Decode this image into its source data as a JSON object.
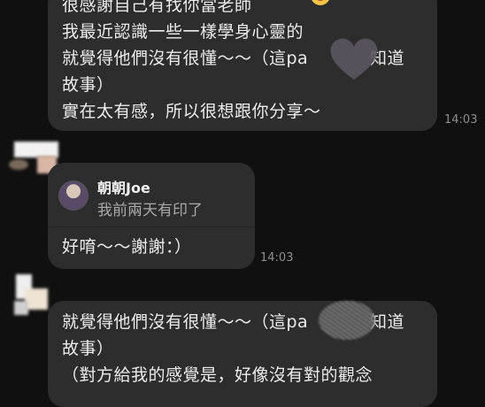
{
  "message_1": {
    "lines": [
      "很感謝自己有找你當老師",
      "我最近認識一些一樣學身心靈的",
      "就覺得他們沒有很懂～～（這pa",
      "故事）",
      "實在太有感，所以很想跟你分享～"
    ],
    "line3_tail": "知道",
    "time": "14:03"
  },
  "message_2": {
    "reply_name": "朝朝Joe",
    "reply_text": "我前兩天有印了",
    "text": "好唷～～謝謝：）",
    "time": "14:03"
  },
  "message_3": {
    "lines": [
      "就覺得他們沒有很懂～～（這pa",
      "故事）",
      "（對方給我的感覺是，好像沒有對的觀念"
    ],
    "line1_tail": "知道"
  },
  "icons": {
    "emoji": "grinning-face-emoji",
    "heart": "heart-sticker",
    "scribble": "redaction-scribble"
  },
  "colors": {
    "background": "#101010",
    "bubble": "#2d2d2d",
    "text": "#ececec",
    "timestamp": "#8d8d8d"
  }
}
